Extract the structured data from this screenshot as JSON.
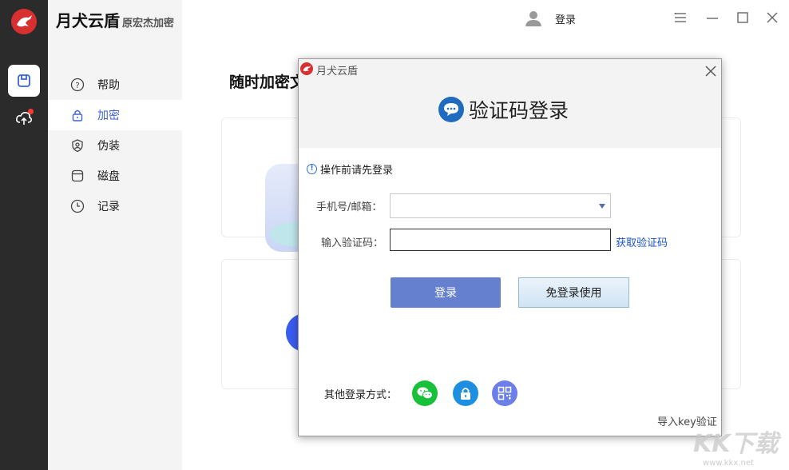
{
  "app": {
    "name": "月犬云盾",
    "subtitle": "原宏杰加密"
  },
  "header": {
    "login_label": "登录"
  },
  "sidebar": {
    "items": [
      {
        "key": "help",
        "label": "帮助"
      },
      {
        "key": "encrypt",
        "label": "加密",
        "active": true
      },
      {
        "key": "disguise",
        "label": "伪装"
      },
      {
        "key": "disk",
        "label": "磁盘"
      },
      {
        "key": "record",
        "label": "记录"
      }
    ]
  },
  "main": {
    "title": "随时加密文"
  },
  "dialog": {
    "app_name": "月犬云盾",
    "heading": "验证码登录",
    "notice": "操作前请先登录",
    "phone_label": "手机号/邮箱：",
    "phone_value": "",
    "code_label": "输入验证码：",
    "code_value": "",
    "get_code": "获取验证码",
    "login_button": "登录",
    "free_button": "免登录使用",
    "other_label": "其他登录方式：",
    "import_key": "导入key验证"
  },
  "watermark": {
    "text": "KK下载",
    "url": "www.kkx.net"
  },
  "colors": {
    "accent": "#3d63d8",
    "brand_red": "#d83030",
    "rail": "#2b2b2b",
    "login_btn": "#6580cf",
    "wechat": "#19c03a",
    "lock": "#1e8fe0",
    "qr": "#6a7fe8"
  }
}
